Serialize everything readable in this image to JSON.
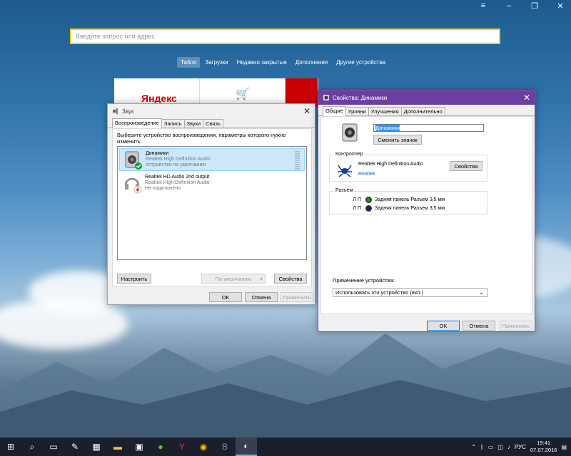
{
  "browser": {
    "address_placeholder": "Введите запрос или адрес",
    "nav_tabs": [
      "Табло",
      "Загрузки",
      "Недавно закрытые",
      "Дополнения",
      "Другие устройства"
    ],
    "tile_yandex": "Яндекс"
  },
  "sound_window": {
    "title": "Звук",
    "tabs": [
      "Воспроизведение",
      "Запись",
      "Звуки",
      "Связь"
    ],
    "description": "Выберите устройство воспроизведения, параметры которого нужно изменить:",
    "devices": [
      {
        "name": "Динамики",
        "driver": "Realtek High Definition Audio",
        "status": "Устройство по умолчанию"
      },
      {
        "name": "Realtek HD Audio 2nd output",
        "driver": "Realtek High Definition Audio",
        "status": "Не подключено"
      }
    ],
    "configure": "Настроить",
    "default_button": "По умолчанию",
    "properties": "Свойства",
    "ok": "OK",
    "cancel": "Отмена",
    "apply": "Применить"
  },
  "props_window": {
    "title": "Свойства: Динамики",
    "tabs": [
      "Общие",
      "Уровни",
      "Улучшения",
      "Дополнительно"
    ],
    "device_name": "Динамики",
    "change_icon": "Сменить значок",
    "controller_label": "Контроллер",
    "controller_name": "Realtek High Definition Audio",
    "controller_link": "Realtek",
    "controller_props": "Свойства",
    "jacks_label": "Разъем",
    "jacks": [
      {
        "lp": "Л П",
        "text": "Задняя панель Разъем 3,5 мм",
        "color": "#1a9c1a"
      },
      {
        "lp": "Л П",
        "text": "Задняя панель Разъем 3,5 мм",
        "color": "#0a1a8a"
      }
    ],
    "usage_label": "Применение устройства:",
    "usage_value": "Использовать это устройство (вкл.)",
    "ok": "OK",
    "cancel": "Отмена",
    "apply": "Применить"
  },
  "taskbar": {
    "time": "19:41",
    "date": "07.07.2016",
    "lang": "РУС"
  },
  "colors": {
    "props_accent": "#6b3fa0",
    "selection": "#cce8ff",
    "address_border": "#f5d000"
  }
}
